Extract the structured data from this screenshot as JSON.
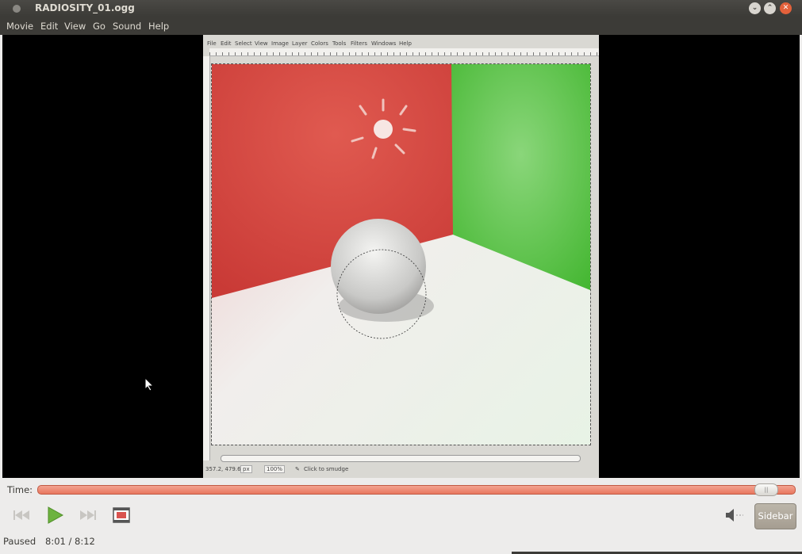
{
  "window": {
    "title": "RADIOSITY_01.ogg"
  },
  "menubar": {
    "items": [
      "Movie",
      "Edit",
      "View",
      "Go",
      "Sound",
      "Help"
    ]
  },
  "gimp": {
    "menu": [
      "File",
      "Edit",
      "Select",
      "View",
      "Image",
      "Layer",
      "Colors",
      "Tools",
      "Filters",
      "Windows",
      "Help"
    ],
    "coords": "357.2, 479.6",
    "unit": "px",
    "zoom": "100%",
    "status": "Click to smudge"
  },
  "controls": {
    "time_label": "Time:",
    "progress": 0.981,
    "sidebar_label": "Sidebar"
  },
  "statusbar": {
    "state": "Paused",
    "time": "8:01 / 8:12"
  },
  "colors": {
    "accent": "#e8775e",
    "titlebar": "#3c3b37",
    "close": "#e3613b"
  }
}
